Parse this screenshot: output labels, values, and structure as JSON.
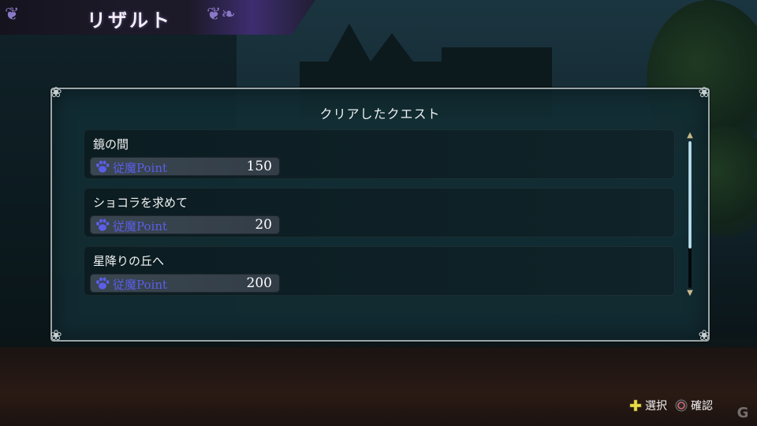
{
  "header": {
    "title": "リザルト"
  },
  "panel": {
    "heading": "クリアしたクエスト",
    "quests": [
      {
        "name": "鏡の間",
        "point_label": "従魔Point",
        "points": "150"
      },
      {
        "name": "ショコラを求めて",
        "point_label": "従魔Point",
        "points": "20"
      },
      {
        "name": "星降りの丘へ",
        "point_label": "従魔Point",
        "points": "200"
      }
    ],
    "scroll_visible_fraction": 0.73
  },
  "footer": {
    "select_label": "選択",
    "confirm_label": "確認"
  },
  "colors": {
    "point_label": "#5b5ee6",
    "panel_bg": "#122e34",
    "title_accent": "#6a5a8e",
    "dpad_yellow": "#e8dc4a",
    "circle_red": "#d86a6a"
  },
  "icons": {
    "paw": "paw-icon",
    "dpad": "dpad-icon",
    "circle": "circle-button-icon",
    "scroll_up": "scroll-up-arrow-icon",
    "scroll_down": "scroll-down-arrow-icon"
  }
}
